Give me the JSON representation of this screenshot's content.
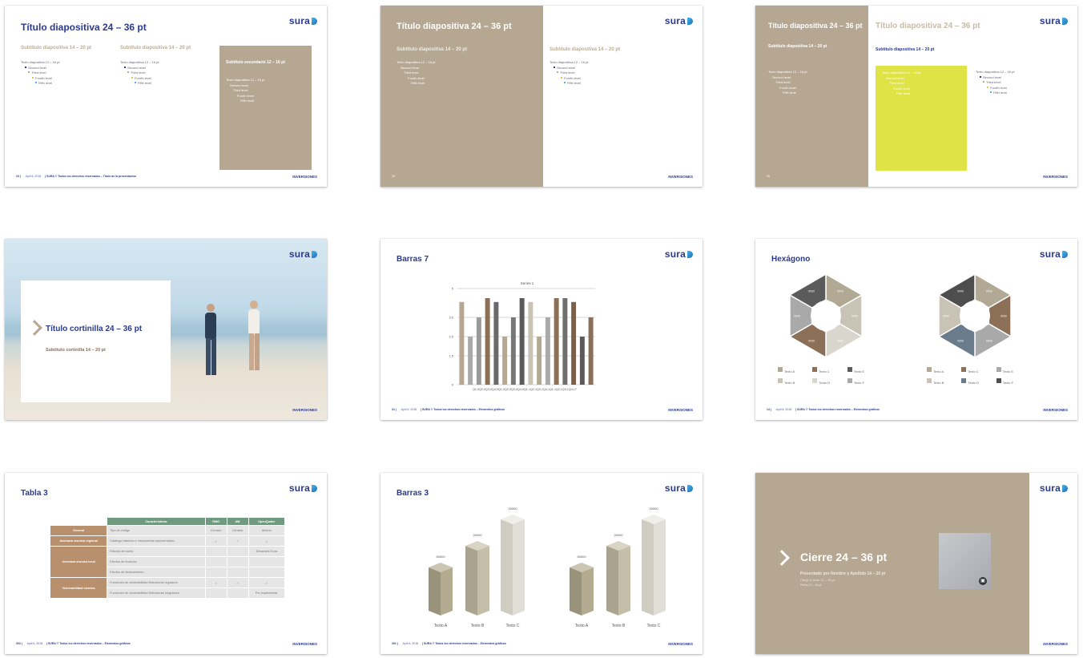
{
  "brand": {
    "logo_text": "sura",
    "footer_right": "INVERSIONES"
  },
  "slides": [
    {
      "title": "Título diapositiva 24 – 36 pt",
      "col1_sub": "Subtítulo diapositiva 14 – 20 pt",
      "col2_sub": "Subtítulo diapositiva 14 – 20 pt",
      "box_sub": "Subtítulo secundario 12 – 16 pt",
      "body": [
        "Texto diapositiva 12 – 16 pt",
        "Second level",
        "Third level",
        "Fourth level",
        "Fifth level"
      ],
      "page": "24 |",
      "date": "April 6, 2018",
      "footer_text": "| SURA © Todos los derechos reservados – Título de la presentación"
    },
    {
      "title": "Título diapositiva 24 – 36 pt",
      "left_sub": "Subtítulo diapositiva 14 – 20 pt",
      "right_sub": "Subtítulo diapositiva 14 – 20 pt",
      "body": [
        "Texto diapositiva 12 – 16 pt",
        "Second level",
        "Third level",
        "Fourth level",
        "Fifth level"
      ],
      "page": "25"
    },
    {
      "left_title": "Título diapositiva 24 – 36 pt",
      "left_sub": "Subtítulo diapositiva 14 – 20 pt",
      "right_title": "Título diapositiva 24 – 36 pt",
      "right_sub": "Subtítulo diapositiva 14 – 20 pt",
      "body": [
        "Texto diapositiva 12 – 16 pt",
        "Second level",
        "Third level",
        "Fourth level",
        "Fifth level"
      ],
      "page": "26"
    },
    {
      "title": "Título cortinilla 24 – 36 pt",
      "subtitle": "Subtítulo cortinilla 14 – 20 pt"
    },
    {
      "title": "Barras 7",
      "page": "31 |",
      "date": "April 6, 2018",
      "footer_text": "| SURA © Todos los derechos reservados – Elementos gráficos",
      "chart_data": {
        "type": "bar",
        "title": "Series 1",
        "ylim": [
          0,
          5
        ],
        "yticks": [
          "5",
          "3.5",
          "2.5",
          "1.5",
          "0"
        ],
        "categories": [
          "Q1-08",
          "Q2-08",
          "Q3-08",
          "Q4-08",
          "Q1-09",
          "Q2-09",
          "Q3-09",
          "Q4-09",
          "Q1-10",
          "Q2-10",
          "Q3-10",
          "Q4-10",
          "Q1-11",
          "Q2-11",
          "Q3-11",
          "Q4-11",
          "Q1-12",
          "Q2-12",
          "Q3-12",
          "Q4-12",
          "Q1-13",
          "Q2-13",
          "Q3-13",
          "Q4-13",
          "Q1-14",
          "Q2-14",
          "Q3-14",
          "Q4-14",
          "Q1-15",
          "Q2-15",
          "Q3-15",
          "Q4-15",
          "Q1-16",
          "Q2-16",
          "Q3-16",
          "Q4-16",
          "Q1-17",
          "Q2-17",
          "Q3-17",
          "Q4-17"
        ],
        "values": [
          4.3,
          2.5,
          3.5,
          4.5,
          4.3,
          2.5,
          3.5,
          4.5,
          4.3,
          2.5,
          3.5,
          4.5,
          4.5,
          4.3,
          2.5,
          3.5
        ],
        "axis_label": "Q1-0Q2-0Q3-0Q4-0Q1-0Q2-0Q3-0Q4-0Q1-1Q2-1Q3-1Q4-1Q1-1Q2-1Q3-1Q4-17"
      }
    },
    {
      "title": "Hexágono",
      "page": "14 |",
      "date": "April 6, 2018",
      "footer_text": "| SURA © Todos los derechos reservados – Elementos gráficos",
      "segment_label": "0000",
      "legend": [
        "Texto A",
        "Texto C",
        "Texto E",
        "Texto B",
        "Texto D",
        "Texto F"
      ],
      "colors_left": [
        "#b2a995",
        "#c9c3b6",
        "#d9d6cd",
        "#8b6f56",
        "#a9a9a9",
        "#5b5b5b"
      ],
      "colors_right": [
        "#b2a995",
        "#8b6f56",
        "#a9a9a9",
        "#6a7c8c",
        "#c9c3b6",
        "#4e4e4e"
      ]
    },
    {
      "title": "Tabla 3",
      "page": "303 |",
      "date": "April 6, 2018",
      "footer_text": "| SURA © Todos los derechos reservados – Elementos gráficos",
      "headers": [
        "Características",
        "RMG",
        "AW",
        "OpenQuake"
      ],
      "rows": [
        [
          "General",
          "Tipo de código",
          "Cerrado",
          "Cerrado",
          "Abierto"
        ],
        [
          "Amenaza sísmica regional",
          "Catálogo histórico e instrumental representativo",
          "✓",
          "○",
          "✓"
        ],
        [
          "Amenaza sísmica local",
          "Efectos del suelo",
          "",
          "",
          "Desarrollo Sura"
        ],
        [
          "",
          "Efectos de licuación",
          "",
          "",
          ""
        ],
        [
          "",
          "Efectos de deslizamiento",
          "",
          "",
          ""
        ],
        [
          "Vulnerabilidad sísmica",
          "Funciones de vulnerabilidad Estructuras regulares",
          "✓",
          "✓",
          "✓"
        ],
        [
          "",
          "Funciones de vulnerabilidad Estructuras irregulares",
          "",
          "",
          "Por implementar"
        ]
      ]
    },
    {
      "title": "Barras 3",
      "page": "301 |",
      "date": "April 6, 2018",
      "footer_text": "| SURA © Todos los derechos reservados – Elementos gráficos",
      "chart_data": {
        "type": "bar",
        "categories": [
          "Texto A",
          "Texto B",
          "Texto C",
          "Texto A",
          "Texto B",
          "Texto C"
        ],
        "values": [
          1,
          1.45,
          2,
          1,
          1.45,
          2
        ],
        "data_labels": [
          "00000",
          "00000",
          "00000",
          "00000",
          "00000",
          "00000"
        ]
      }
    },
    {
      "title": "Cierre 24 – 36 pt",
      "subtitle": "Presentado por Nombre y Apellido 14 – 20 pt",
      "line2": "Cargo o título 12 – 16 pt",
      "line3": "Fecha 12 – 16 pt"
    }
  ]
}
